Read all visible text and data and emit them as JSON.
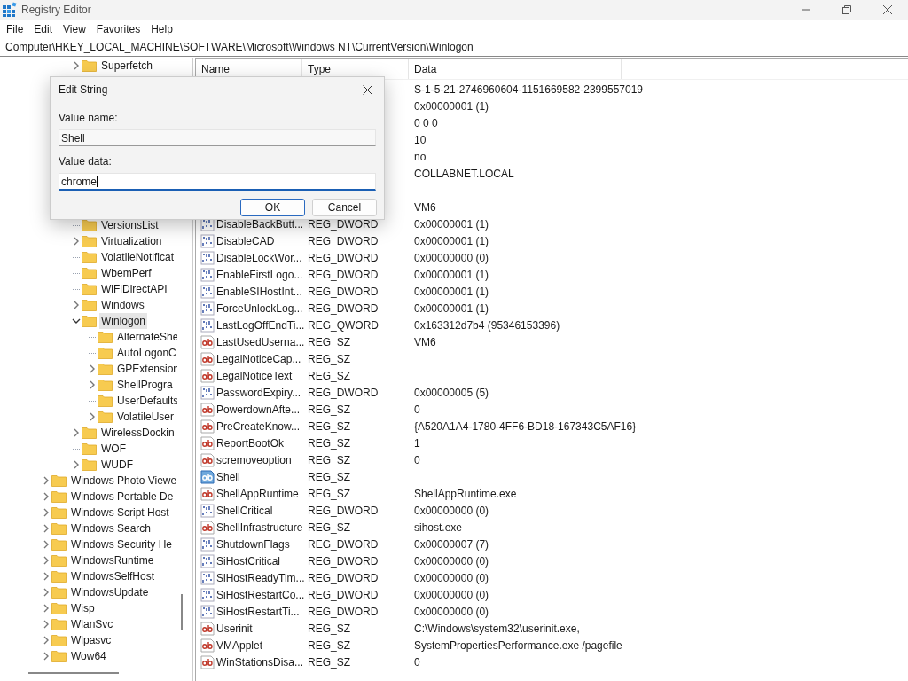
{
  "window": {
    "title": "Registry Editor"
  },
  "menu": [
    "File",
    "Edit",
    "View",
    "Favorites",
    "Help"
  ],
  "address": "Computer\\HKEY_LOCAL_MACHINE\\SOFTWARE\\Microsoft\\Windows NT\\CurrentVersion\\Winlogon",
  "tree": {
    "current_version_keys_top": [
      {
        "label": "Superfetch",
        "expanded": false,
        "selected": false
      }
    ],
    "current_version_keys": [
      {
        "label": "VersionsList",
        "selected": false
      },
      {
        "label": "Virtualization",
        "expanded": false,
        "selected": false
      },
      {
        "label": "VolatileNotificat",
        "selected": false
      },
      {
        "label": "WbemPerf",
        "selected": false
      },
      {
        "label": "WiFiDirectAPI",
        "selected": false
      },
      {
        "label": "Windows",
        "expanded": false,
        "selected": false
      },
      {
        "label": "Winlogon",
        "expanded": true,
        "selected": true,
        "children": [
          {
            "label": "AlternateShe",
            "selected": false
          },
          {
            "label": "AutoLogonC",
            "selected": false
          },
          {
            "label": "GPExtension",
            "expanded": false,
            "selected": false
          },
          {
            "label": "ShellProgra",
            "expanded": false,
            "selected": false
          },
          {
            "label": "UserDefaults",
            "selected": false
          },
          {
            "label": "VolatileUser",
            "expanded": false,
            "selected": false
          }
        ]
      },
      {
        "label": "WirelessDockin",
        "expanded": false,
        "selected": false
      },
      {
        "label": "WOF",
        "selected": false
      },
      {
        "label": "WUDF",
        "expanded": false,
        "selected": false
      }
    ],
    "microsoft_keys": [
      {
        "label": "Windows Photo Viewe",
        "expanded": false,
        "selected": false
      },
      {
        "label": "Windows Portable De",
        "expanded": false,
        "selected": false
      },
      {
        "label": "Windows Script Host",
        "expanded": false,
        "selected": false
      },
      {
        "label": "Windows Search",
        "expanded": false,
        "selected": false
      },
      {
        "label": "Windows Security He",
        "expanded": false,
        "selected": false
      },
      {
        "label": "WindowsRuntime",
        "expanded": false,
        "selected": false
      },
      {
        "label": "WindowsSelfHost",
        "expanded": false,
        "selected": false
      },
      {
        "label": "WindowsUpdate",
        "expanded": false,
        "selected": false
      },
      {
        "label": "Wisp",
        "expanded": false,
        "selected": false
      },
      {
        "label": "WlanSvc",
        "expanded": false,
        "selected": false
      },
      {
        "label": "Wlpasvc",
        "expanded": false,
        "selected": false
      },
      {
        "label": "Wow64",
        "expanded": false,
        "selected": false
      }
    ]
  },
  "table": {
    "columns": [
      "Name",
      "Type",
      "Data"
    ],
    "rows": [
      {
        "data": "S-1-5-21-2746960604-1151669582-2399557019"
      },
      {
        "data": "0x00000001 (1)"
      },
      {
        "data": "0 0 0"
      },
      {
        "data": "10"
      },
      {
        "data": "no"
      },
      {
        "data": "COLLABNET.LOCAL"
      },
      {},
      {
        "data": "VM6"
      },
      {
        "kind": "binary",
        "name": "DisableBackButt...",
        "type": "REG_DWORD",
        "data": "0x00000001 (1)",
        "selected": false
      },
      {
        "kind": "binary",
        "name": "DisableCAD",
        "type": "REG_DWORD",
        "data": "0x00000001 (1)",
        "selected": false
      },
      {
        "kind": "binary",
        "name": "DisableLockWor...",
        "type": "REG_DWORD",
        "data": "0x00000000 (0)",
        "selected": false
      },
      {
        "kind": "binary",
        "name": "EnableFirstLogo...",
        "type": "REG_DWORD",
        "data": "0x00000001 (1)",
        "selected": false
      },
      {
        "kind": "binary",
        "name": "EnableSIHostInt...",
        "type": "REG_DWORD",
        "data": "0x00000001 (1)",
        "selected": false
      },
      {
        "kind": "binary",
        "name": "ForceUnlockLog...",
        "type": "REG_DWORD",
        "data": "0x00000001 (1)",
        "selected": false
      },
      {
        "kind": "binary",
        "name": "LastLogOffEndTi...",
        "type": "REG_QWORD",
        "data": "0x163312d7b4 (95346153396)",
        "selected": false
      },
      {
        "kind": "string",
        "name": "LastUsedUserna...",
        "type": "REG_SZ",
        "data": "VM6",
        "selected": false
      },
      {
        "kind": "string",
        "name": "LegalNoticeCap...",
        "type": "REG_SZ",
        "selected": false
      },
      {
        "kind": "string",
        "name": "LegalNoticeText",
        "type": "REG_SZ",
        "selected": false
      },
      {
        "kind": "binary",
        "name": "PasswordExpiry...",
        "type": "REG_DWORD",
        "data": "0x00000005 (5)",
        "selected": false
      },
      {
        "kind": "string",
        "name": "PowerdownAfte...",
        "type": "REG_SZ",
        "data": "0",
        "selected": false
      },
      {
        "kind": "string",
        "name": "PreCreateKnow...",
        "type": "REG_SZ",
        "data": "{A520A1A4-1780-4FF6-BD18-167343C5AF16}",
        "selected": false
      },
      {
        "kind": "string",
        "name": "ReportBootOk",
        "type": "REG_SZ",
        "data": "1",
        "selected": false
      },
      {
        "kind": "string",
        "name": "scremoveoption",
        "type": "REG_SZ",
        "data": "0",
        "selected": false
      },
      {
        "kind": "string",
        "name": "Shell",
        "type": "REG_SZ",
        "selected": true
      },
      {
        "kind": "string",
        "name": "ShellAppRuntime",
        "type": "REG_SZ",
        "data": "ShellAppRuntime.exe",
        "selected": false
      },
      {
        "kind": "binary",
        "name": "ShellCritical",
        "type": "REG_DWORD",
        "data": "0x00000000 (0)",
        "selected": false
      },
      {
        "kind": "string",
        "name": "ShellInfrastructure",
        "type": "REG_SZ",
        "data": "sihost.exe",
        "selected": false
      },
      {
        "kind": "binary",
        "name": "ShutdownFlags",
        "type": "REG_DWORD",
        "data": "0x00000007 (7)",
        "selected": false
      },
      {
        "kind": "binary",
        "name": "SiHostCritical",
        "type": "REG_DWORD",
        "data": "0x00000000 (0)",
        "selected": false
      },
      {
        "kind": "binary",
        "name": "SiHostReadyTim...",
        "type": "REG_DWORD",
        "data": "0x00000000 (0)",
        "selected": false
      },
      {
        "kind": "binary",
        "name": "SiHostRestartCo...",
        "type": "REG_DWORD",
        "data": "0x00000000 (0)",
        "selected": false
      },
      {
        "kind": "binary",
        "name": "SiHostRestartTi...",
        "type": "REG_DWORD",
        "data": "0x00000000 (0)",
        "selected": false
      },
      {
        "kind": "string",
        "name": "Userinit",
        "type": "REG_SZ",
        "data": "C:\\Windows\\system32\\userinit.exe,",
        "selected": false
      },
      {
        "kind": "string",
        "name": "VMApplet",
        "type": "REG_SZ",
        "data": "SystemPropertiesPerformance.exe /pagefile",
        "selected": false
      },
      {
        "kind": "string",
        "name": "WinStationsDisa...",
        "type": "REG_SZ",
        "data": "0",
        "selected": false
      }
    ]
  },
  "dialog": {
    "title": "Edit String",
    "name_label": "Value name:",
    "name_value": "Shell",
    "data_label": "Value data:",
    "data_value": "chrome",
    "buttons": [
      {
        "label": "OK",
        "default": true
      },
      {
        "label": "Cancel",
        "default": false
      }
    ]
  }
}
